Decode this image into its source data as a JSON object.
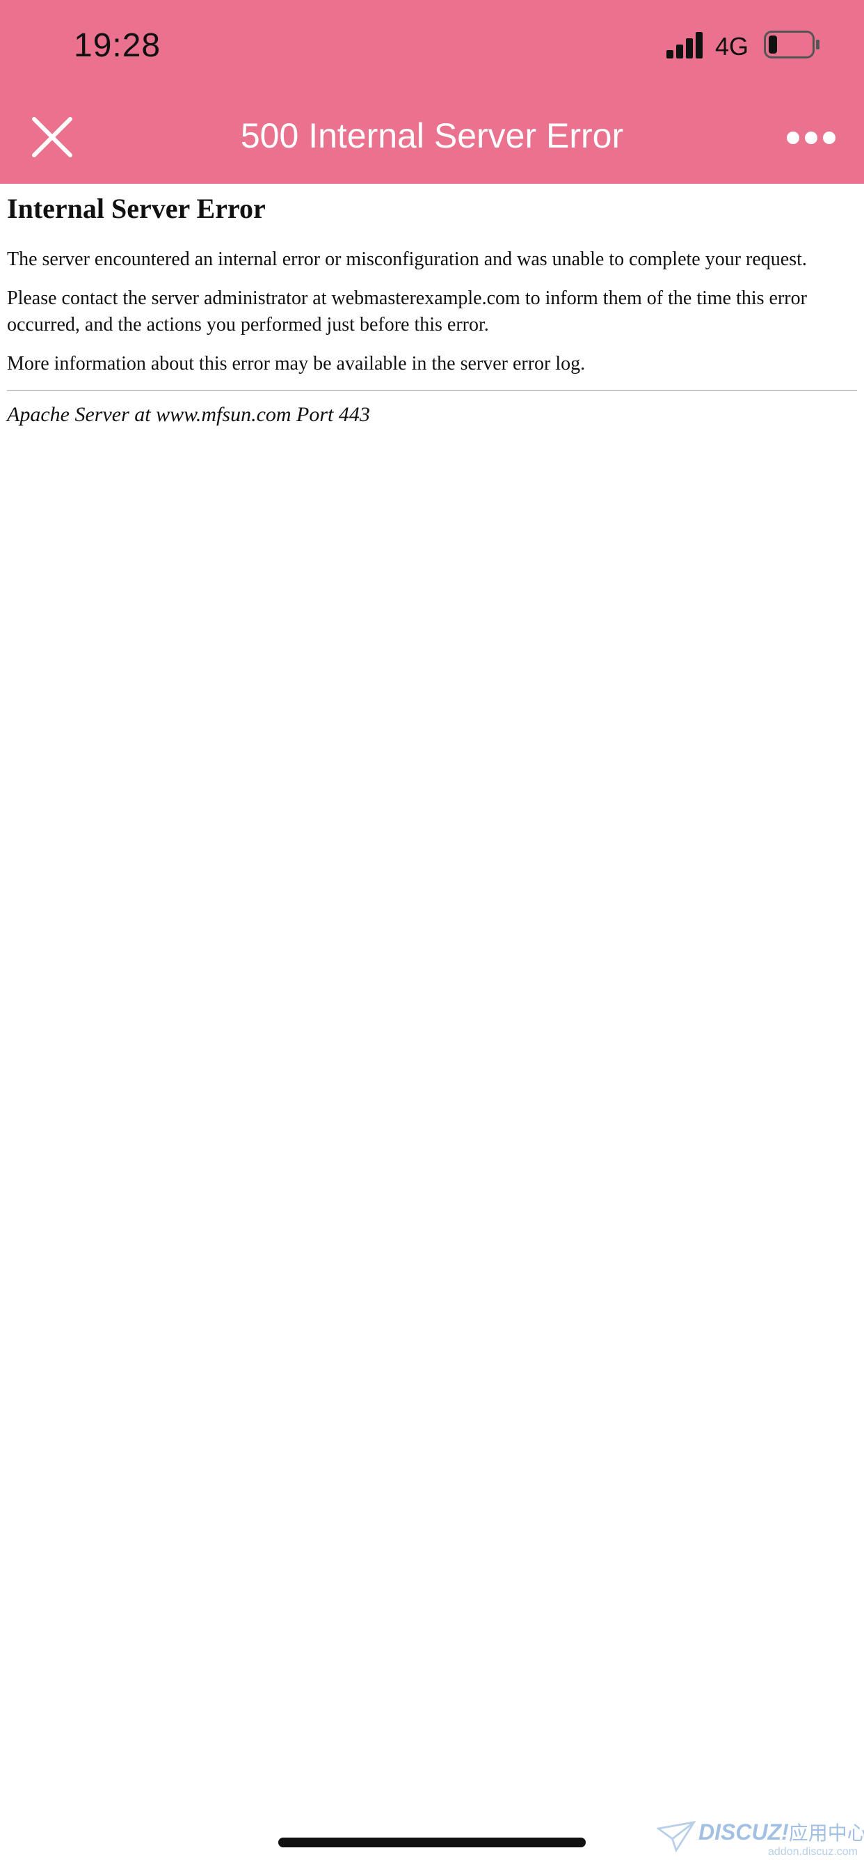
{
  "status_bar": {
    "time": "19:28",
    "network": "4G",
    "battery_level": 0.2
  },
  "header": {
    "title": "500 Internal Server Error",
    "background_color": "#EA728F",
    "close_icon": "close-icon",
    "more_icon": "more-dots-icon"
  },
  "content": {
    "heading": "Internal Server Error",
    "paragraph_1": "The server encountered an internal error or misconfiguration and was unable to complete your request.",
    "paragraph_2": "Please contact the server administrator at webmasterexample.com to inform them of the time this error occurred, and the actions you performed just before this error.",
    "paragraph_3": "More information about this error may be available in the server error log.",
    "footer": "Apache Server at www.mfsun.com Port 443"
  },
  "watermark": {
    "brand": "DISCUZ!",
    "suffix": "应用中心",
    "url": "addon.discuz.com"
  }
}
